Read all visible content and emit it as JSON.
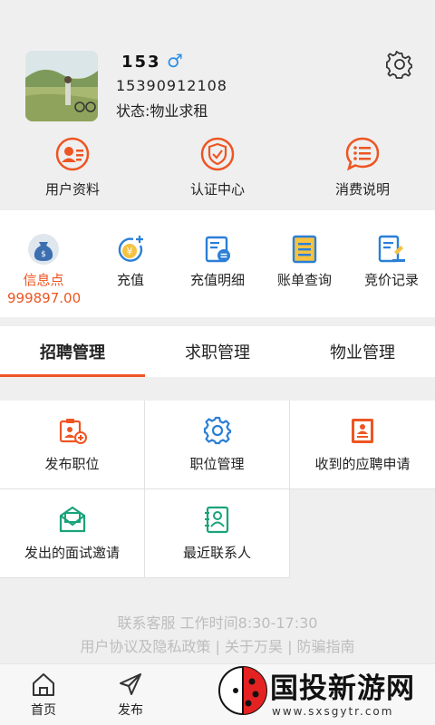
{
  "user": {
    "name": "153",
    "gender_symbol": "♂",
    "phone": "15390912108",
    "status": "状态:物业求租"
  },
  "top_menu": [
    {
      "label": "用户资料",
      "icon": "user-profile-icon"
    },
    {
      "label": "认证中心",
      "icon": "shield-check-icon"
    },
    {
      "label": "消费说明",
      "icon": "chat-list-icon"
    }
  ],
  "finance": {
    "items": [
      {
        "label": "信息点",
        "icon": "money-bag-icon"
      },
      {
        "label": "充值",
        "icon": "recharge-icon"
      },
      {
        "label": "充值明细",
        "icon": "recharge-detail-icon"
      },
      {
        "label": "账单查询",
        "icon": "bill-icon"
      },
      {
        "label": "竞价记录",
        "icon": "bid-record-icon"
      }
    ],
    "balance": "999897.00"
  },
  "tabs": [
    {
      "label": "招聘管理",
      "active": true
    },
    {
      "label": "求职管理",
      "active": false
    },
    {
      "label": "物业管理",
      "active": false
    }
  ],
  "grid": [
    {
      "label": "发布职位",
      "icon": "post-job-icon"
    },
    {
      "label": "职位管理",
      "icon": "gear-icon"
    },
    {
      "label": "收到的应聘申请",
      "icon": "resume-icon"
    },
    {
      "label": "发出的面试邀请",
      "icon": "invitation-icon"
    },
    {
      "label": "最近联系人",
      "icon": "contacts-icon"
    }
  ],
  "footer": {
    "service": "联系客服 工作时间8:30-17:30",
    "links": "用户协议及隐私政策 | 关于万昊 | 防骗指南"
  },
  "bottom_nav": [
    {
      "label": "首页",
      "icon": "home-icon"
    },
    {
      "label": "发布",
      "icon": "send-icon"
    }
  ],
  "watermark": {
    "text": "国投新游网",
    "url": "www.sxsgytr.com"
  },
  "colors": {
    "accent": "#ee5522",
    "header_bg": "#efefef",
    "gender_blue": "#2b8ee6",
    "icon_blue": "#2b7fd6",
    "footer_text": "#bdbdbd"
  }
}
